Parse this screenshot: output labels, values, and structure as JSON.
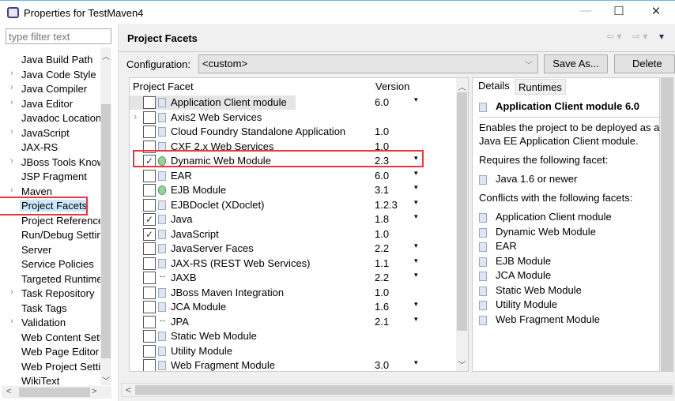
{
  "window": {
    "title": "Properties for TestMaven4",
    "minimize": "—",
    "maximize": "☐",
    "close": "✕"
  },
  "sidebar": {
    "filter_placeholder": "type filter text",
    "items": [
      {
        "label": "Java Build Path",
        "expandable": false
      },
      {
        "label": "Java Code Style",
        "expandable": true
      },
      {
        "label": "Java Compiler",
        "expandable": true
      },
      {
        "label": "Java Editor",
        "expandable": true
      },
      {
        "label": "Javadoc Location",
        "expandable": false
      },
      {
        "label": "JavaScript",
        "expandable": true
      },
      {
        "label": "JAX-RS",
        "expandable": false
      },
      {
        "label": "JBoss Tools Knowledge Base",
        "expandable": true
      },
      {
        "label": "JSP Fragment",
        "expandable": false
      },
      {
        "label": "Maven",
        "expandable": true
      },
      {
        "label": "Project Facets",
        "expandable": false,
        "selected": true
      },
      {
        "label": "Project References",
        "expandable": false
      },
      {
        "label": "Run/Debug Settings",
        "expandable": false
      },
      {
        "label": "Server",
        "expandable": false
      },
      {
        "label": "Service Policies",
        "expandable": false
      },
      {
        "label": "Targeted Runtimes",
        "expandable": false
      },
      {
        "label": "Task Repository",
        "expandable": true
      },
      {
        "label": "Task Tags",
        "expandable": false
      },
      {
        "label": "Validation",
        "expandable": true
      },
      {
        "label": "Web Content Settings",
        "expandable": false
      },
      {
        "label": "Web Page Editor",
        "expandable": false
      },
      {
        "label": "Web Project Settings",
        "expandable": false
      },
      {
        "label": "WikiText",
        "expandable": false
      }
    ]
  },
  "header": {
    "title": "Project Facets",
    "back": "⇦ ▾",
    "forward": "⇨ ▾",
    "menu": "▾"
  },
  "config": {
    "label": "Configuration:",
    "value": "<custom>",
    "save_as": "Save As...",
    "delete": "Delete"
  },
  "table": {
    "col_facet": "Project Facet",
    "col_version": "Version",
    "rows": [
      {
        "name": "Application Client module",
        "version": "6.0",
        "checked": false,
        "dropdown": true,
        "icon": "doc"
      },
      {
        "name": "Axis2 Web Services",
        "version": "",
        "checked": false,
        "dropdown": false,
        "icon": "doc",
        "expandable": true
      },
      {
        "name": "Cloud Foundry Standalone Application",
        "version": "1.0",
        "checked": false,
        "dropdown": false,
        "icon": "doc"
      },
      {
        "name": "CXF 2.x Web Services",
        "version": "1.0",
        "checked": false,
        "dropdown": false,
        "icon": "doc"
      },
      {
        "name": "Dynamic Web Module",
        "version": "2.3",
        "checked": true,
        "dropdown": true,
        "icon": "globe",
        "highlighted": true
      },
      {
        "name": "EAR",
        "version": "6.0",
        "checked": false,
        "dropdown": true,
        "icon": "doc"
      },
      {
        "name": "EJB Module",
        "version": "3.1",
        "checked": false,
        "dropdown": true,
        "icon": "globe"
      },
      {
        "name": "EJBDoclet (XDoclet)",
        "version": "1.2.3",
        "checked": false,
        "dropdown": true,
        "icon": "doc"
      },
      {
        "name": "Java",
        "version": "1.8",
        "checked": true,
        "dropdown": true,
        "icon": "doc"
      },
      {
        "name": "JavaScript",
        "version": "1.0",
        "checked": true,
        "dropdown": false,
        "icon": "doc"
      },
      {
        "name": "JavaServer Faces",
        "version": "2.2",
        "checked": false,
        "dropdown": true,
        "icon": "doc"
      },
      {
        "name": "JAX-RS (REST Web Services)",
        "version": "1.1",
        "checked": false,
        "dropdown": true,
        "icon": "doc"
      },
      {
        "name": "JAXB",
        "version": "2.2",
        "checked": false,
        "dropdown": true,
        "icon": "arrows"
      },
      {
        "name": "JBoss Maven Integration",
        "version": "1.0",
        "checked": false,
        "dropdown": false,
        "icon": "doc"
      },
      {
        "name": "JCA Module",
        "version": "1.6",
        "checked": false,
        "dropdown": true,
        "icon": "doc"
      },
      {
        "name": "JPA",
        "version": "2.1",
        "checked": false,
        "dropdown": true,
        "icon": "arrows"
      },
      {
        "name": "Static Web Module",
        "version": "",
        "checked": false,
        "dropdown": false,
        "icon": "doc"
      },
      {
        "name": "Utility Module",
        "version": "",
        "checked": false,
        "dropdown": false,
        "icon": "doc"
      },
      {
        "name": "Web Fragment Module",
        "version": "3.0",
        "checked": false,
        "dropdown": true,
        "icon": "doc"
      }
    ]
  },
  "details": {
    "tabs": [
      "Details",
      "Runtimes"
    ],
    "heading": "Application Client module 6.0",
    "description": [
      "Enables the project to be deployed as a",
      "Java EE Application Client module."
    ],
    "requires_label": "Requires the following facet:",
    "requires": [
      "Java 1.6 or newer"
    ],
    "conflicts_label": "Conflicts with the following facets:",
    "conflicts": [
      "Application Client module",
      "Dynamic Web Module",
      "EAR",
      "EJB Module",
      "JCA Module",
      "Static Web Module",
      "Utility Module",
      "Web Fragment Module"
    ]
  },
  "colors": {
    "highlight_box": "#e8383d",
    "selection": "#cce8ff"
  }
}
